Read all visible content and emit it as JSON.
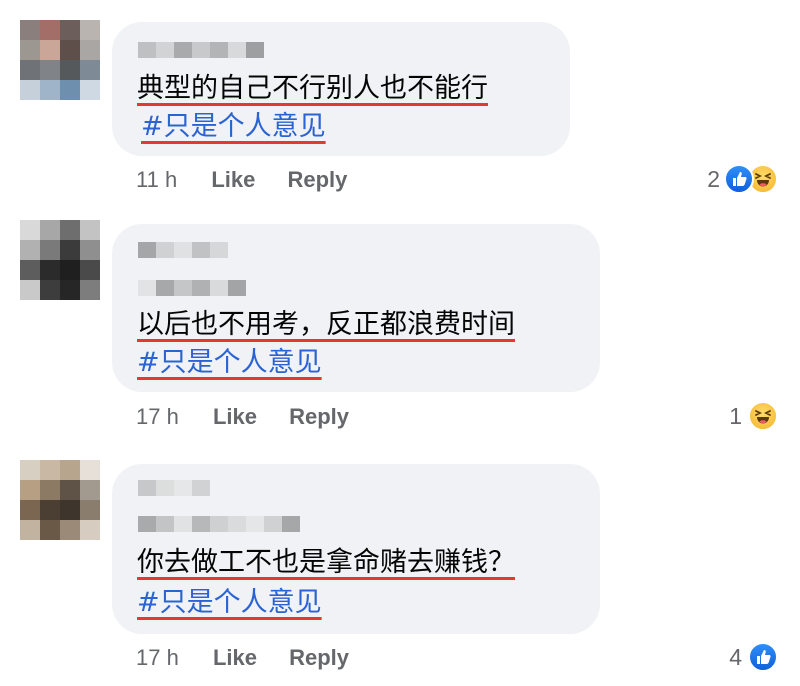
{
  "comments": [
    {
      "text": "典型的自己不行别人也不能行",
      "hashtag": "#只是个人意见",
      "time": "11 h",
      "like_label": "Like",
      "reply_label": "Reply",
      "reaction_count": "2",
      "reactions": [
        "like-icon",
        "haha-icon"
      ]
    },
    {
      "text": "以后也不用考，反正都浪费时间",
      "hashtag": "#只是个人意见",
      "time": "17 h",
      "like_label": "Like",
      "reply_label": "Reply",
      "reaction_count": "1",
      "reactions": [
        "haha-icon"
      ]
    },
    {
      "text": "你去做工不也是拿命赌去赚钱？",
      "hashtag": "#只是个人意见",
      "time": "17 h",
      "like_label": "Like",
      "reply_label": "Reply",
      "reaction_count": "4",
      "reactions": [
        "like-icon"
      ]
    }
  ],
  "colors": {
    "bubble": "#f0f2f5",
    "hashtag": "#2a64d4",
    "underline": "#e23b2e",
    "meta": "#65676b",
    "like": "#1877f2",
    "haha": "#f7b125"
  }
}
